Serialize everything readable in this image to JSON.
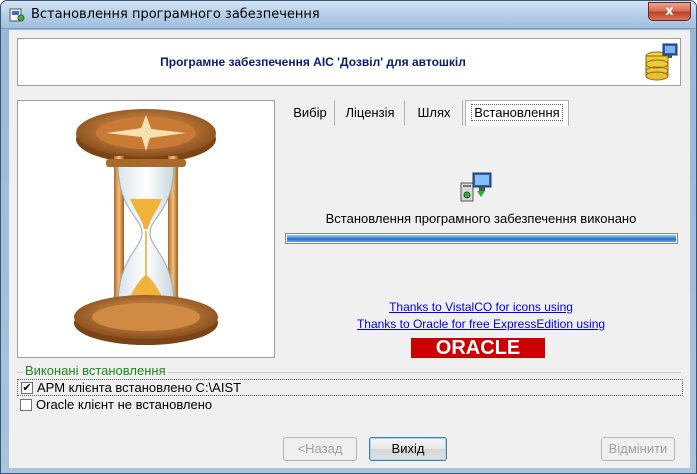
{
  "window": {
    "title": "Встановлення програмного забезпечення",
    "close_label": "x"
  },
  "header": {
    "title": "Програмне забезпечення АІС 'Дозвіл' для автошкіл"
  },
  "tabs": [
    {
      "label": "Вибір",
      "active": false
    },
    {
      "label": "Ліцензія",
      "active": false
    },
    {
      "label": "Шлях",
      "active": false
    },
    {
      "label": "Встановлення",
      "active": true
    }
  ],
  "install": {
    "status_text": "Встановлення програмного забезпечення виконано",
    "progress_fraction": 1.0
  },
  "credits": {
    "link1": "Thanks to VistalCO for icons using",
    "link2": "Thanks to Oracle for free ExpressEdition using",
    "oracle_logo_text": "ORACLE"
  },
  "completed": {
    "legend": "Виконані встановлення",
    "items": [
      {
        "label": "АРМ клієнта встановлено C:\\AIST",
        "checked": true
      },
      {
        "label": "Oracle клієнт не встановлено",
        "checked": false
      }
    ]
  },
  "buttons": {
    "back": "<Назад",
    "exit": "Вихід",
    "cancel": "Відмінити"
  },
  "colors": {
    "header_title": "#0a1a78",
    "legend": "#1a8a1a",
    "progress": "#3f8be0",
    "oracle_red": "#cc0000",
    "link": "#0000ee"
  }
}
